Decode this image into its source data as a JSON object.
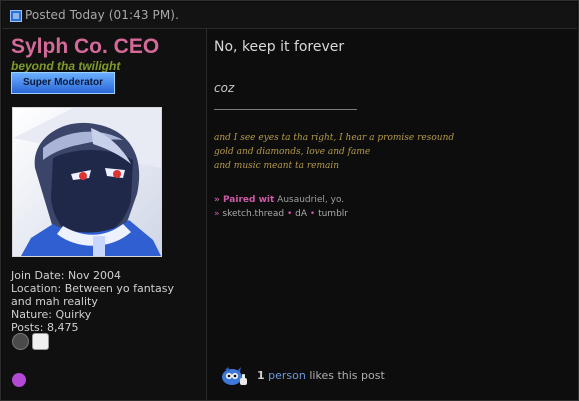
{
  "header": {
    "posted_label": "Posted Today (01:43 PM)."
  },
  "user": {
    "name": "Sylph Co. CEO",
    "title": "beyond tha twilight",
    "rank": "Super Moderator",
    "join_date": "Join Date: Nov 2004",
    "location_line1": "Location: Between yo fantasy",
    "location_line2": "and mah reality",
    "nature": "Nature: Quirky",
    "posts": "Posts: 8,475"
  },
  "post": {
    "message": "No, keep it forever",
    "coz": "coz",
    "lyrics": [
      "and I see eyes ta tha right, I hear a promise resound",
      "gold and diamonds, love and fame",
      "and music meant ta remain"
    ],
    "signature": {
      "paired_label": "» Paired wit",
      "partner_name": "Ausaudriel",
      "paired_suffix": ", yo.",
      "bullet": "»",
      "link1": "sketch.thread",
      "sep": "•",
      "link2": "dA",
      "link3": "tumblr"
    },
    "likes": {
      "count": "1",
      "person": "person",
      "text": "likes this post"
    }
  },
  "colors": {
    "username": "#d56a9a",
    "title": "#7f9a2a",
    "lyric": "#b59a4a",
    "accent": "#cc5aa6"
  }
}
